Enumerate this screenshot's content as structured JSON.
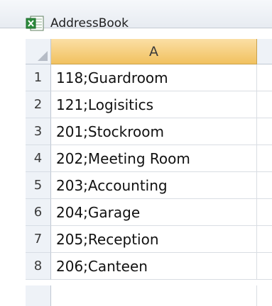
{
  "window": {
    "title": "AddressBook",
    "icon": "excel-workbook-icon"
  },
  "sheet": {
    "columns": [
      "A"
    ],
    "rows": [
      {
        "num": "1",
        "value": "118;Guardroom"
      },
      {
        "num": "2",
        "value": "121;Logisitics"
      },
      {
        "num": "3",
        "value": "201;Stockroom"
      },
      {
        "num": "4",
        "value": "202;Meeting Room"
      },
      {
        "num": "5",
        "value": "203;Accounting"
      },
      {
        "num": "6",
        "value": "204;Garage"
      },
      {
        "num": "7",
        "value": "205;Reception"
      },
      {
        "num": "8",
        "value": "206;Canteen"
      }
    ]
  },
  "colors": {
    "selected_column_header": "#f1c15f",
    "header_background": "#eef2f7",
    "gridline": "#d9dde3"
  }
}
